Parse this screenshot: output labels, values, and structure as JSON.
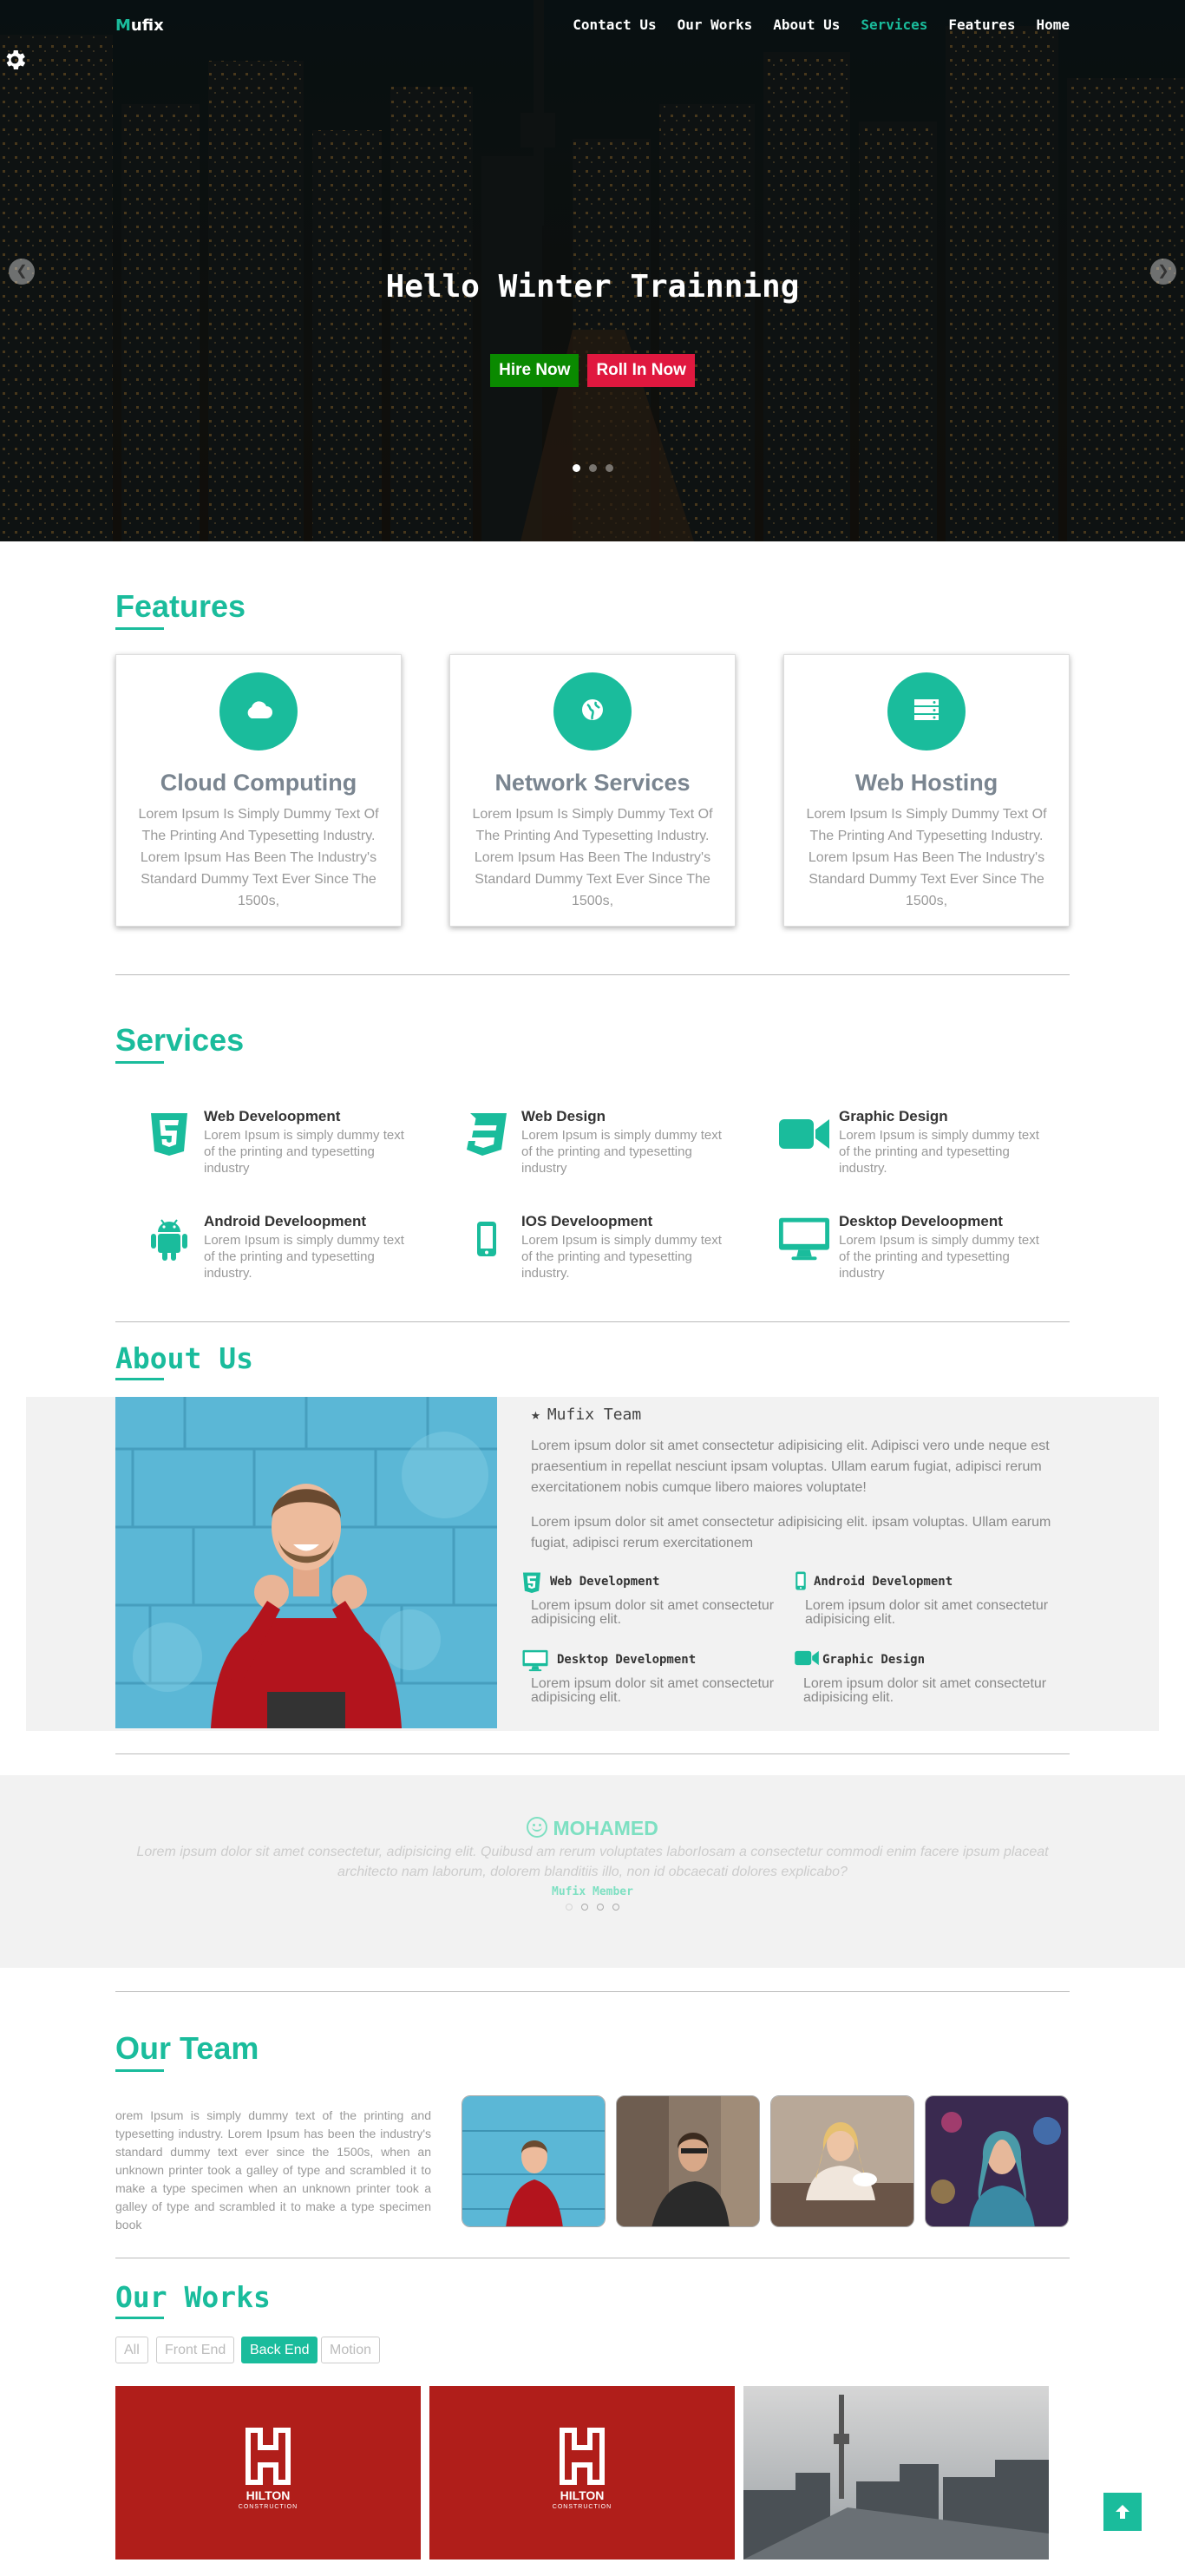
{
  "nav": {
    "logo_first": "M",
    "logo_rest": "ufix",
    "links": [
      "Contact Us",
      "Our Works",
      "About Us",
      "Services",
      "Features",
      "Home"
    ],
    "active_index": 3
  },
  "hero": {
    "title": "Hello Winter Trainning",
    "btn_hire": "Hire Now",
    "btn_roll": "Roll In Now",
    "slide_count": 3,
    "active_slide": 0
  },
  "colors": {
    "accent": "#1abc9c",
    "hire": "#0a8a00",
    "roll": "#e0183f",
    "work_red": "#b01e1a"
  },
  "features": {
    "heading": "Features",
    "items": [
      {
        "icon": "cloud-icon",
        "title": "Cloud Computing",
        "text": "Lorem Ipsum Is Simply Dummy Text Of The Printing And Typesetting Industry. Lorem Ipsum Has Been The Industry's Standard Dummy Text Ever Since The 1500s,"
      },
      {
        "icon": "globe-icon",
        "title": "Network Services",
        "text": "Lorem Ipsum Is Simply Dummy Text Of The Printing And Typesetting Industry. Lorem Ipsum Has Been The Industry's Standard Dummy Text Ever Since The 1500s,"
      },
      {
        "icon": "server-icon",
        "title": "Web Hosting",
        "text": "Lorem Ipsum Is Simply Dummy Text Of The Printing And Typesetting Industry. Lorem Ipsum Has Been The Industry's Standard Dummy Text Ever Since The 1500s,"
      }
    ]
  },
  "services": {
    "heading": "Services",
    "items": [
      {
        "icon": "html5-icon",
        "title": "Web Develoopment",
        "text": "Lorem Ipsum is simply dummy text of the printing and typesetting industry"
      },
      {
        "icon": "css3-icon",
        "title": "Web Design",
        "text": "Lorem Ipsum is simply dummy text of the printing and typesetting industry"
      },
      {
        "icon": "video-camera-icon",
        "title": "Graphic Design",
        "text": "Lorem Ipsum is simply dummy text of the printing and typesetting industry."
      },
      {
        "icon": "android-icon",
        "title": "Android Develoopment",
        "text": "Lorem Ipsum is simply dummy text of the printing and typesetting industry."
      },
      {
        "icon": "mobile-icon",
        "title": "IOS Develoopment",
        "text": "Lorem Ipsum is simply dummy text of the printing and typesetting industry."
      },
      {
        "icon": "desktop-icon",
        "title": "Desktop Develoopment",
        "text": "Lorem Ipsum is simply dummy text of the printing and typesetting industry"
      }
    ]
  },
  "about": {
    "heading": "About Us",
    "team_title": "Mufix Team",
    "p1": "Lorem ipsum dolor sit amet consectetur adipisicing elit. Adipisci vero unde neque est praesentium in repellat nesciunt ipsam voluptas. Ullam earum fugiat, adipisci rerum exercitationem nobis cumque libero maiores voluptate!",
    "p2": "Lorem ipsum dolor sit amet consectetur adipisicing elit. ipsam voluptas. Ullam earum fugiat, adipisci rerum exercitationem",
    "items": [
      {
        "icon": "html5-icon",
        "title": "Web Development",
        "text": "Lorem ipsum dolor sit amet consectetur adipisicing elit."
      },
      {
        "icon": "mobile-icon",
        "title": "Android Development",
        "text": "Lorem ipsum dolor sit amet consectetur adipisicing elit."
      },
      {
        "icon": "desktop-icon",
        "title": "Desktop Development",
        "text": "Lorem ipsum dolor sit amet consectetur adipisicing elit."
      },
      {
        "icon": "video-camera-icon",
        "title": "Graphic Design",
        "text": "Lorem ipsum dolor sit amet consectetur adipisicing elit."
      }
    ]
  },
  "testimonial": {
    "name": "MOHAMED",
    "quote": "Lorem ipsum dolor sit amet consectetur, adipisicing elit. Quibusd am rerum voluptates laborIosam a consectetur commodi enim facere ipsum placeat architecto nam laborum, dolorem blanditiis illo, non id obcaecati dolores explicabo?",
    "role": "Mufix Member",
    "dot_count": 4,
    "active_dot": 0
  },
  "team": {
    "heading_a": "Our",
    "heading_b": " Team",
    "text": "orem Ipsum is simply dummy text of the printing and typesetting industry. Lorem Ipsum has been the industry's standard dummy text ever since the 1500s, when an unknown printer took a galley of type and scrambled it to make a type specimen when an unknown printer took a galley of type and scrambled it to make a type specimen book"
  },
  "works": {
    "heading": "Our Works",
    "filters": [
      "All",
      "Front End",
      "Back End",
      "Motion"
    ],
    "active_filter": 2,
    "logo_text": "HILTON",
    "logo_sub": "CONSTRUCTION"
  }
}
